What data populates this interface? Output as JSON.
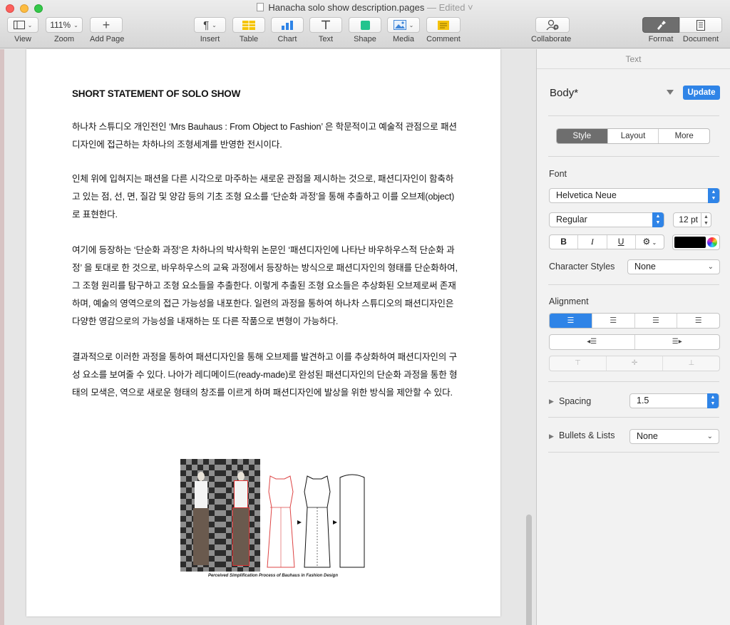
{
  "window": {
    "title": "Hanacha solo show description.pages",
    "title_status": "— Edited ˅"
  },
  "toolbar": {
    "view_label": "View",
    "zoom_value": "111%",
    "zoom_label": "Zoom",
    "add_page_label": "Add Page",
    "insert_label": "Insert",
    "table_label": "Table",
    "chart_label": "Chart",
    "text_label": "Text",
    "shape_label": "Shape",
    "media_label": "Media",
    "comment_label": "Comment",
    "collaborate_label": "Collaborate",
    "format_label": "Format",
    "document_label": "Document"
  },
  "document": {
    "heading": "SHORT STATEMENT OF SOLO SHOW",
    "paragraphs": [
      "하나차 스튜디오 개인전인 ‘Mrs Bauhaus : From Object to Fashion’ 은 학문적이고 예술적 관점으로 패션디자인에 접근하는 차하나의 조형세계를 반영한 전시이다.",
      "인체 위에 입혀지는 패션을 다른 시각으로 마주하는 새로운 관점을 제시하는 것으로, 패션디자인이 함축하고 있는 점, 선, 면, 질감 및 양감 등의 기초 조형 요소를 ‘단순화 과정’을 통해 추출하고 이를 오브제(object)로 표현한다.",
      "여기에 등장하는 ‘단순화 과정’은 차하나의 박사학위 논문인 ‘패션디자인에 나타난 바우하우스적 단순화 과정’ 을 토대로 한 것으로, 바우하우스의 교육 과정에서 등장하는 방식으로 패션디자인의 형태를 단순화하여, 그 조형 원리를 탐구하고 조형 요소들을 추출한다. 이렇게 추출된 조형 요소들은 추상화된 오브제로써 존재하며, 예술의 영역으로의 접근 가능성을 내포한다. 일련의 과정을 통하여 하나차 스튜디오의 패션디자인은 다양한 영감으로의 가능성을 내재하는 또 다른 작품으로 변형이 가능하다.",
      "결과적으로 이러한 과정을 통하여 패션디자인을 통해 오브제를 발견하고 이를 추상화하여 패션디자인의 구성 요소를 보여줄 수 있다. 나아가 레디메이드(ready-made)로 완성된 패션디자인의 단순화 과정을 통한 형태의 모색은, 역으로 새로운 형태의 창조를 이르게 하며 패션디자인에 발상을 위한 방식을 제안할 수 있다."
    ],
    "figure_caption": "Perceived Simplification Process of Bauhaus in Fashion Design"
  },
  "inspector": {
    "header": "Text",
    "paragraph_style": "Body*",
    "update_label": "Update",
    "tabs": [
      "Style",
      "Layout",
      "More"
    ],
    "font_label": "Font",
    "font_family": "Helvetica Neue",
    "font_weight": "Regular",
    "font_size": "12 pt",
    "bold": "B",
    "italic": "I",
    "underline": "U",
    "gear": "⚙",
    "text_color": "#000000",
    "character_styles_label": "Character Styles",
    "character_styles_value": "None",
    "alignment_label": "Alignment",
    "spacing_label": "Spacing",
    "spacing_value": "1.5",
    "bullets_label": "Bullets & Lists",
    "bullets_value": "None"
  },
  "colors": {
    "accent": "#2f84e7",
    "selected_tab": "#6e6e6e"
  }
}
